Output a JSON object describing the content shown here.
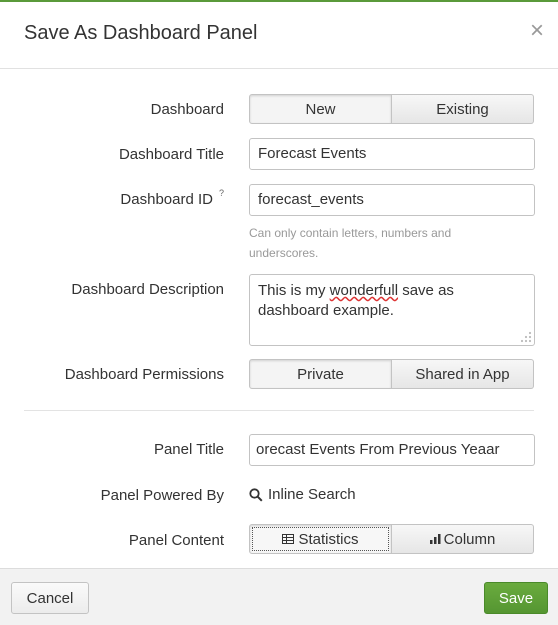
{
  "dialog": {
    "title": "Save As Dashboard Panel",
    "close_glyph": "×"
  },
  "fields": {
    "dashboard": {
      "label": "Dashboard",
      "options": [
        "New",
        "Existing"
      ],
      "selected": "New"
    },
    "title": {
      "label": "Dashboard Title",
      "value": "Forecast Events"
    },
    "id": {
      "label": "Dashboard ID",
      "help_mark": "?",
      "value": "forecast_events",
      "help": "Can only contain letters, numbers and underscores."
    },
    "description": {
      "label": "Dashboard Description",
      "value_pre": "This is my ",
      "value_misspelled": "wonderfull",
      "value_post": " save as dashboard example."
    },
    "permissions": {
      "label": "Dashboard Permissions",
      "options": [
        "Private",
        "Shared in App"
      ],
      "selected": "Private"
    },
    "panel_title": {
      "label": "Panel Title",
      "value": "orecast Events From Previous Yeaar"
    },
    "powered_by": {
      "label": "Panel Powered By",
      "value": "Inline Search",
      "icon": "search-icon"
    },
    "panel_content": {
      "label": "Panel Content",
      "options": [
        "Statistics",
        "Column"
      ],
      "selected": "Statistics",
      "icons": [
        "table-icon",
        "bar-chart-icon"
      ]
    }
  },
  "footer": {
    "cancel_label": "Cancel",
    "save_label": "Save"
  },
  "colors": {
    "save_button": "#5a9d35",
    "top_accent": "#5a9a3a"
  }
}
